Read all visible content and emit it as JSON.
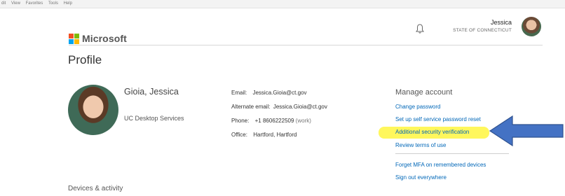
{
  "menubar": [
    "dit",
    "View",
    "Favorites",
    "Tools",
    "Help"
  ],
  "brand": {
    "name": "Microsoft",
    "colors": [
      "#f25022",
      "#7fba00",
      "#00a4ef",
      "#ffb900"
    ]
  },
  "header": {
    "bell_icon": "notification-bell-icon",
    "user_name": "Jessica",
    "user_org": "STATE OF CONNECTICUT"
  },
  "page": {
    "title": "Profile",
    "section_devices": "Devices & activity"
  },
  "person": {
    "name": "Gioia, Jessica",
    "department": "UC Desktop Services"
  },
  "details": {
    "email_label": "Email:",
    "email_value": "Jessica.Gioia@ct.gov",
    "alt_email_label": "Alternate email:",
    "alt_email_value": "Jessica.Gioia@ct.gov",
    "phone_label": "Phone:",
    "phone_value": "+1 8606222509",
    "phone_type": "(work)",
    "office_label": "Office:",
    "office_value": "Hartford, Hartford"
  },
  "manage": {
    "title": "Manage account",
    "links": [
      "Change password",
      "Set up self service password reset",
      "Additional security verification",
      "Review terms of use",
      "Forget MFA on remembered devices",
      "Sign out everywhere"
    ],
    "link_color": "#0067b8",
    "highlight_color": "#fff600"
  },
  "annotation": {
    "arrow_color": "#4472c4"
  }
}
